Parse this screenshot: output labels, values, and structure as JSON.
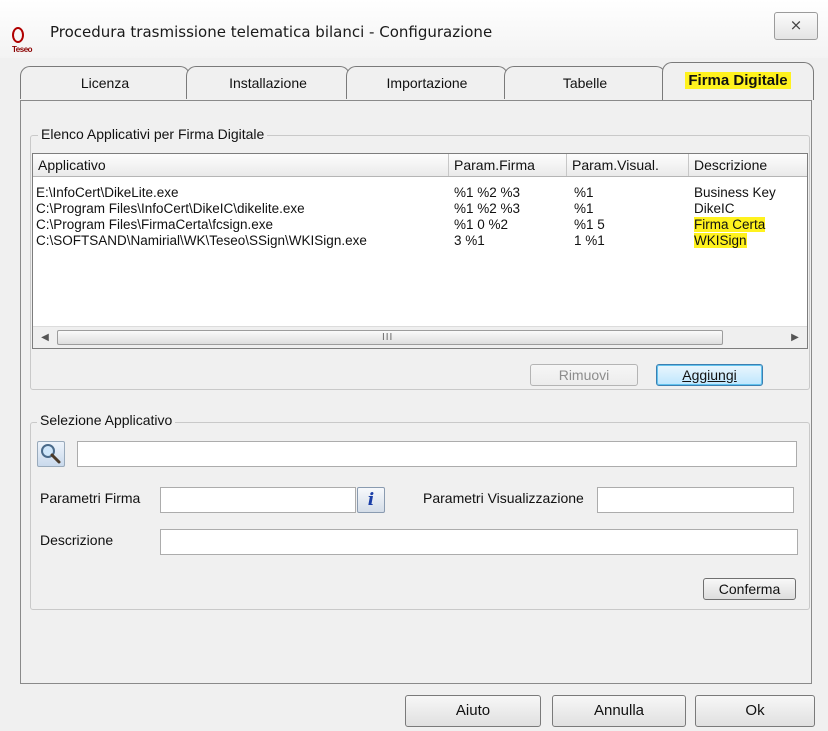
{
  "window": {
    "title": "Procedura trasmissione telematica bilanci - Configurazione",
    "logo_text": "Teseo",
    "close_glyph": "⨯"
  },
  "tabs": [
    {
      "label": "Licenza"
    },
    {
      "label": "Installazione"
    },
    {
      "label": "Importazione"
    },
    {
      "label": "Tabelle"
    },
    {
      "label": "Firma Digitale",
      "active": true
    }
  ],
  "app_list": {
    "group_title": "Elenco Applicativi  per Firma Digitale",
    "columns": [
      "Applicativo",
      "Param.Firma",
      "Param.Visual.",
      "Descrizione"
    ],
    "rows": [
      {
        "applicativo": "E:\\InfoCert\\DikeLite.exe",
        "param_firma": "%1 %2 %3",
        "param_visual": "%1",
        "descrizione": "Business Key",
        "highlight": false
      },
      {
        "applicativo": "C:\\Program Files\\InfoCert\\DikeIC\\dikelite.exe",
        "param_firma": "%1 %2 %3",
        "param_visual": "%1",
        "descrizione": "DikeIC",
        "highlight": false
      },
      {
        "applicativo": "C:\\Program Files\\FirmaCerta\\fcsign.exe",
        "param_firma": "%1 0 %2",
        "param_visual": "%1 5",
        "descrizione": "Firma Certa",
        "highlight": true
      },
      {
        "applicativo": "C:\\SOFTSAND\\Namirial\\WK\\Teseo\\SSign\\WKISign.exe",
        "param_firma": "3 %1",
        "param_visual": "1 %1",
        "descrizione": "WKISign",
        "highlight": true
      }
    ],
    "scroll_left": "◀",
    "scroll_right": "▶",
    "scroll_grip": "III",
    "remove_label": "Rimuovi",
    "add_label": "Aggiungi"
  },
  "selection": {
    "group_title": "Selezione Applicativo",
    "path_value": "",
    "param_firma_label": "Parametri Firma",
    "param_firma_value": "",
    "info_glyph": "i",
    "param_visual_label": "Parametri Visualizzazione",
    "param_visual_value": "",
    "descrizione_label": "Descrizione",
    "descrizione_value": "",
    "confirm_label": "Conferma"
  },
  "footer": {
    "help_label": "Aiuto",
    "cancel_label": "Annulla",
    "ok_label": "Ok"
  },
  "colors": {
    "highlight": "#fff21e",
    "default_button": "#bee6fd"
  }
}
